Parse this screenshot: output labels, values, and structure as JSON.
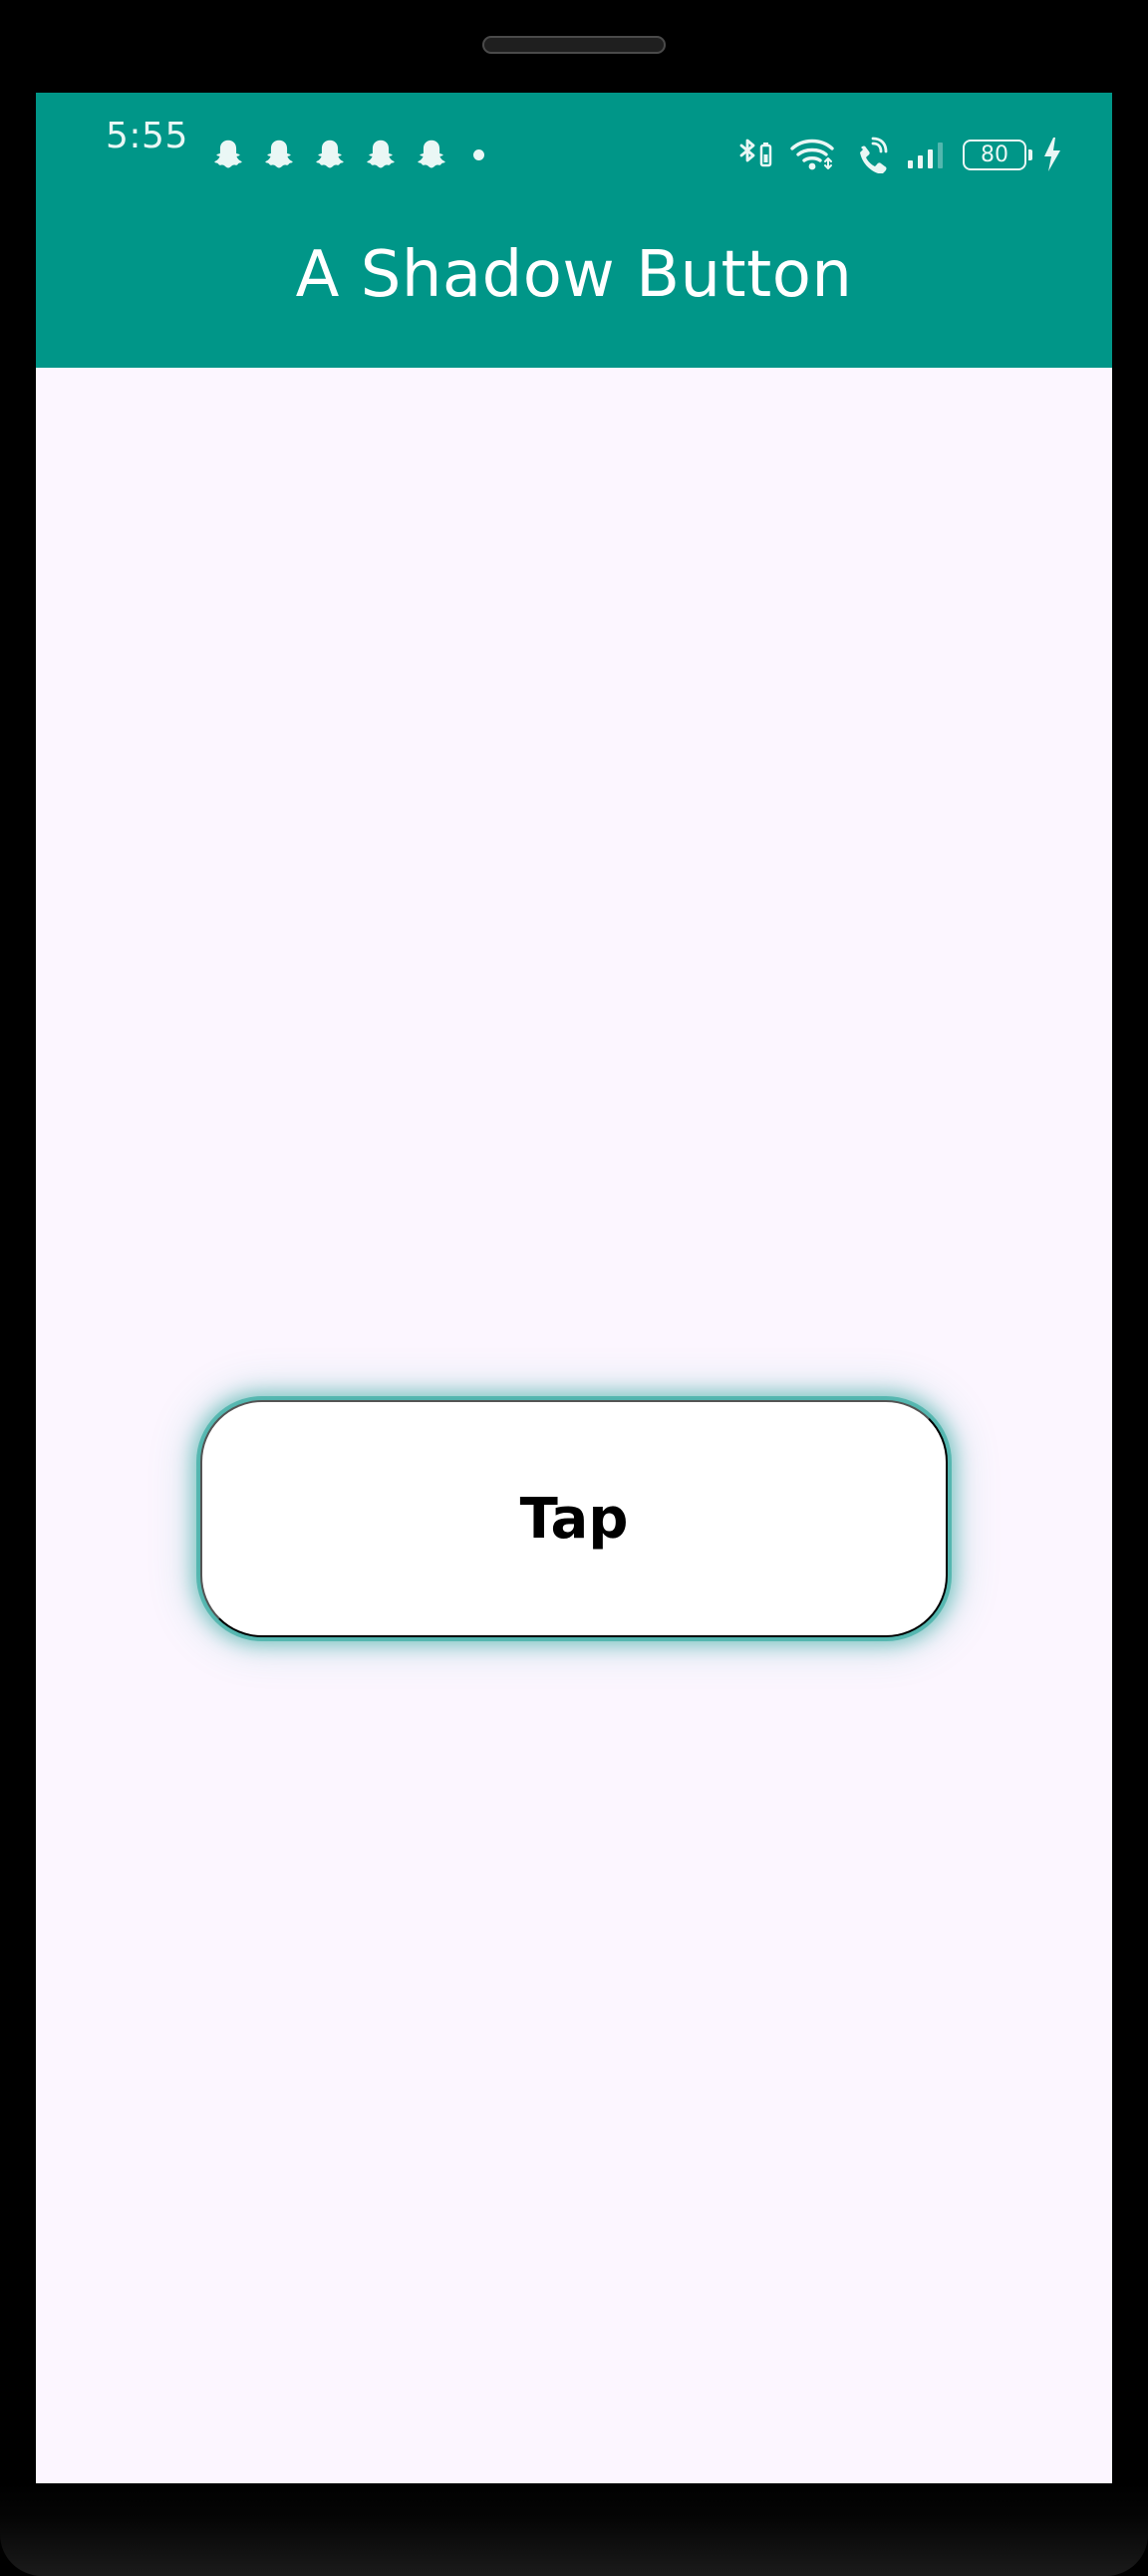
{
  "status_bar": {
    "time": "5:55",
    "notification_icons": [
      "snapchat-icon",
      "snapchat-icon",
      "snapchat-icon",
      "snapchat-icon",
      "snapchat-icon"
    ],
    "more_notifications_indicator": "dot-icon",
    "bluetooth_battery_icon": "bluetooth-battery-icon",
    "wifi_icon": "wifi-icon",
    "call_icon": "wifi-calling-icon",
    "signal_icon": "cellular-signal-icon",
    "battery_level": "80",
    "charging_icon": "charging-bolt-icon"
  },
  "app_bar": {
    "title": "A Shadow Button"
  },
  "main": {
    "button_label": "Tap"
  },
  "colors": {
    "accent": "#009688",
    "background": "#FCF6FF",
    "button_surface": "#FFFFFF",
    "button_text": "#000000"
  }
}
